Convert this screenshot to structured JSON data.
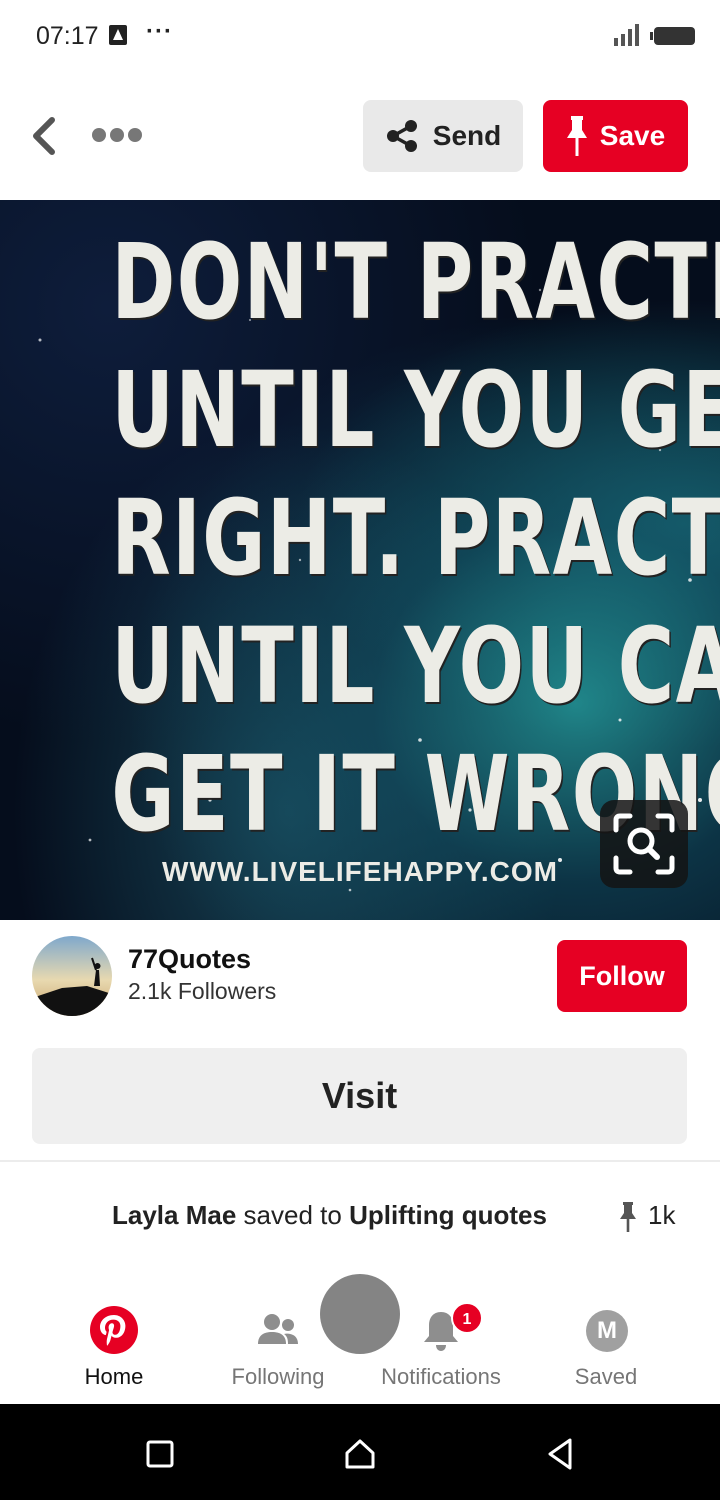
{
  "status_bar": {
    "time": "07:17",
    "dots": "···"
  },
  "header": {
    "send_label": "Send",
    "save_label": "Save"
  },
  "pin": {
    "quote_lines": [
      "DON'T PRACTICE",
      "UNTIL YOU GET IT",
      "RIGHT. PRACTICE",
      "UNTIL YOU CAN'T",
      "GET IT WRONG."
    ],
    "url": "WWW.LIVELIFEHAPPY.COM"
  },
  "creator": {
    "name": "77Quotes",
    "followers": "2.1k Followers",
    "follow_label": "Follow"
  },
  "visit_label": "Visit",
  "saved_activity": {
    "user": "Layla Mae",
    "middle": "saved to",
    "board": "Uplifting quotes",
    "count": "1k"
  },
  "bottom_nav": {
    "items": [
      {
        "label": "Home",
        "icon": "pinterest-logo-icon"
      },
      {
        "label": "Following",
        "icon": "people-icon"
      },
      {
        "label": "Notifications",
        "icon": "bell-icon",
        "badge": "1"
      },
      {
        "label": "Saved",
        "icon": "profile-avatar",
        "avatar_letter": "M"
      }
    ]
  },
  "colors": {
    "brand_red": "#e60023",
    "button_grey": "#e9e9e9"
  }
}
